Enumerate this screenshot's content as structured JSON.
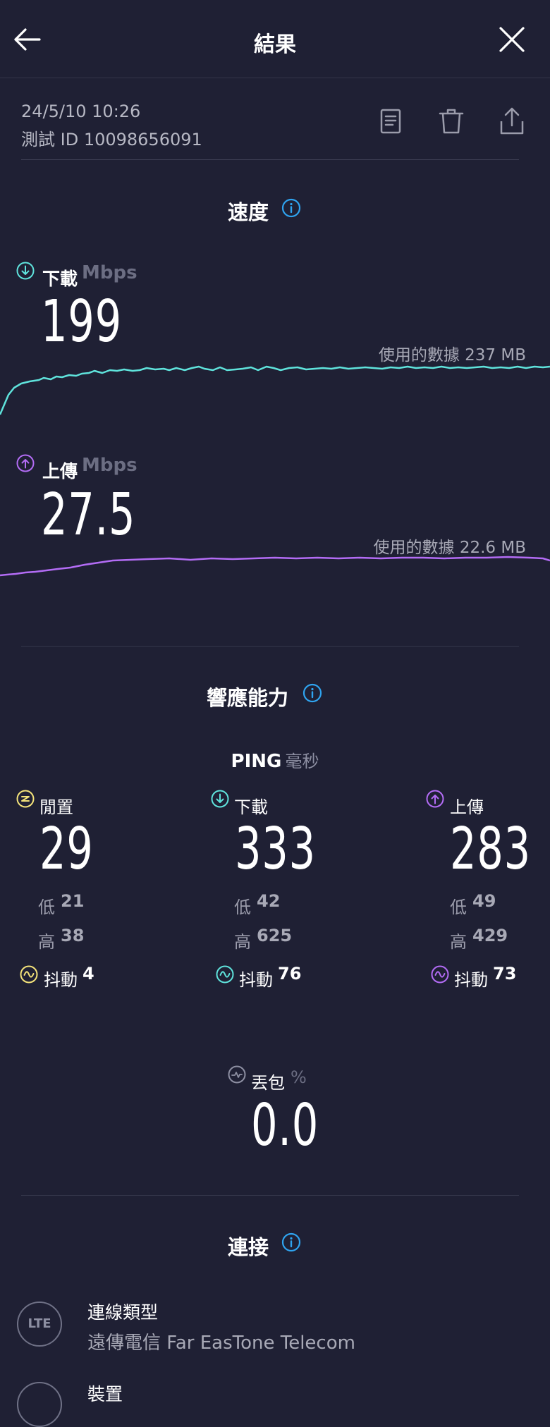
{
  "header": {
    "title": "結果",
    "back_icon": "arrow-left-icon",
    "close_icon": "close-icon"
  },
  "meta": {
    "date": "24/5/10 10:26",
    "test_id": "測試 ID 10098656091",
    "actions": [
      "document-icon",
      "trash-icon",
      "share-icon"
    ]
  },
  "speed": {
    "title": "速度",
    "download": {
      "label": "下載",
      "unit": "Mbps",
      "value": "199",
      "data_used": "使用的數據 237 MB",
      "color": "#5fe3dc"
    },
    "upload": {
      "label": "上傳",
      "unit": "Mbps",
      "value": "27.5",
      "data_used": "使用的數據 22.6 MB",
      "color": "#b36cf5"
    }
  },
  "responsiveness": {
    "title": "響應能力",
    "ping_title": "PING",
    "ping_unit": "毫秒",
    "low_label": "低",
    "high_label": "高",
    "jitter_label": "抖動",
    "columns": [
      {
        "label": "閒置",
        "value": "29",
        "low": "21",
        "high": "38",
        "jitter": "4",
        "color": "#f4e37a"
      },
      {
        "label": "下載",
        "value": "333",
        "low": "42",
        "high": "625",
        "jitter": "76",
        "color": "#5fe3dc"
      },
      {
        "label": "上傳",
        "value": "283",
        "low": "49",
        "high": "429",
        "jitter": "73",
        "color": "#b36cf5"
      }
    ],
    "packet_loss": {
      "label": "丟包",
      "unit": "%",
      "value": "0.0"
    }
  },
  "connection": {
    "title": "連接",
    "type_label": "連線類型",
    "type_value": "遠傳電信 Far EasTone Telecom",
    "lte_badge": "LTE",
    "next_label": "裝置"
  },
  "colors": {
    "background": "#1f2034",
    "info_blue": "#2fa4f0"
  }
}
